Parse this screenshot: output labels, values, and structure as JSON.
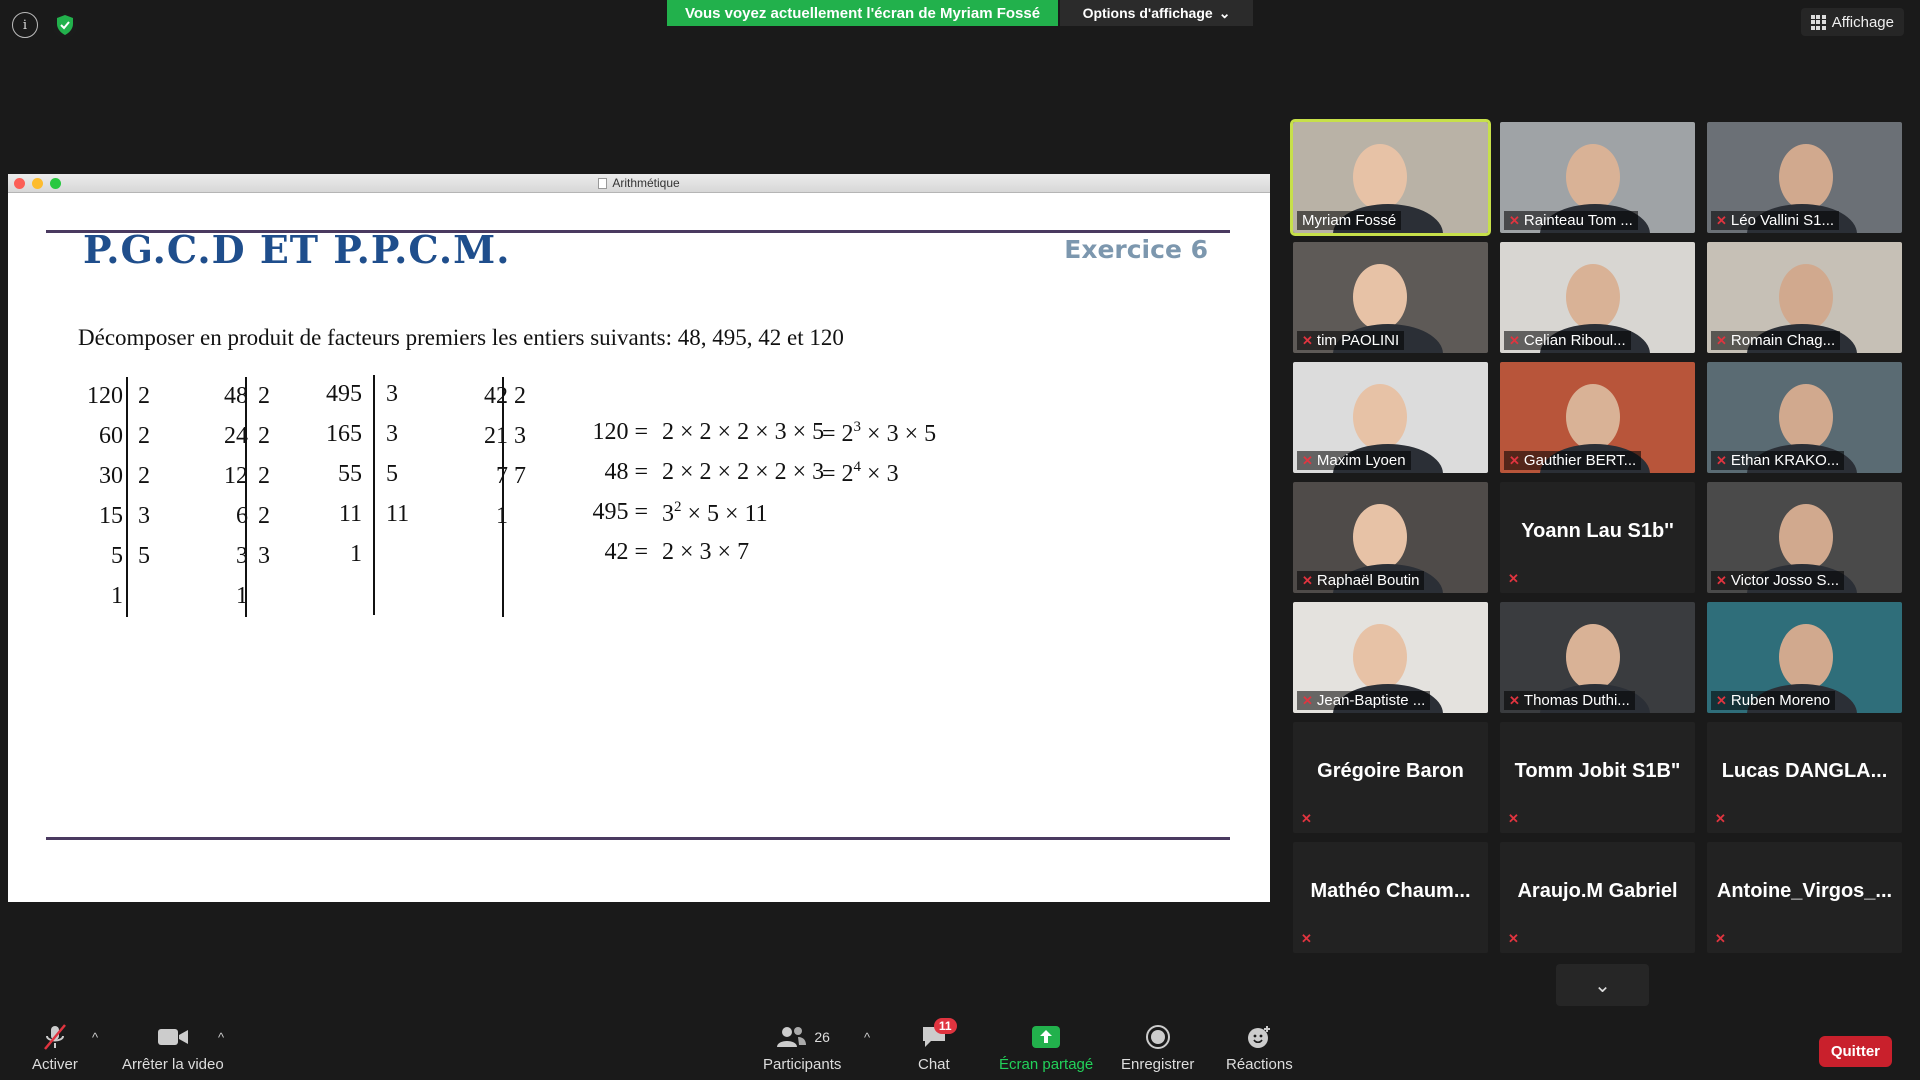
{
  "top": {
    "share_banner": "Vous voyez actuellement l'écran de Myriam Fossé",
    "view_options": "Options d'affichage",
    "view_button": "Affichage"
  },
  "window": {
    "title": "Arithmétique"
  },
  "slide": {
    "title": "P.G.C.D ET P.P.C.M.",
    "exercise": "Exercice 6",
    "instruction": "Décomposer en produit de facteurs premiers les entiers suivants: 48, 495, 42 et 120",
    "table120": {
      "left": [
        "120",
        "60",
        "30",
        "15",
        "5",
        "1"
      ],
      "right": [
        "2",
        "2",
        "2",
        "3",
        "5",
        ""
      ]
    },
    "table48": {
      "left": [
        "48",
        "24",
        "12",
        "6",
        "3",
        "1"
      ],
      "right": [
        "2",
        "2",
        "2",
        "2",
        "3",
        ""
      ]
    },
    "table495": {
      "left": [
        "495",
        "165",
        "55",
        "11",
        "1"
      ],
      "right": [
        "3",
        "3",
        "5",
        "11",
        ""
      ]
    },
    "table42": {
      "left": [
        "42",
        "21",
        "7",
        "1"
      ],
      "right": [
        "2",
        "3",
        "7",
        ""
      ]
    },
    "results": [
      {
        "lhs": "120 =",
        "rhs": "2 × 2 × 2 × 3 × 5",
        "pow": "= 2",
        "exp": "3",
        "rest": " × 3 × 5"
      },
      {
        "lhs": "48 =",
        "rhs": "2 × 2 × 2 × 2 × 3",
        "pow": "= 2",
        "exp": "4",
        "rest": " × 3"
      },
      {
        "lhs": "495 =",
        "rhs": "3",
        "exp": "2",
        "rest": " × 5 × 11"
      },
      {
        "lhs": "42 =",
        "rhs": "2 × 3 × 7"
      }
    ]
  },
  "participants": [
    {
      "name": "Myriam Fossé",
      "video": true,
      "active": true,
      "muted": false
    },
    {
      "name": "Rainteau Tom ...",
      "video": true,
      "muted": true
    },
    {
      "name": "Léo Vallini S1...",
      "video": true,
      "muted": true
    },
    {
      "name": "tim PAOLINI",
      "video": true,
      "muted": true
    },
    {
      "name": "Celian Riboul...",
      "video": true,
      "muted": true
    },
    {
      "name": "Romain Chag...",
      "video": true,
      "muted": true
    },
    {
      "name": "Maxim Lyoen",
      "video": true,
      "muted": true
    },
    {
      "name": "Gauthier BERT...",
      "video": true,
      "muted": true
    },
    {
      "name": "Ethan KRAKO...",
      "video": true,
      "muted": true
    },
    {
      "name": "Raphaël Boutin",
      "video": true,
      "muted": true
    },
    {
      "name": "Yoann Lau S1b''",
      "video": false,
      "muted": true
    },
    {
      "name": "Victor Josso S...",
      "video": true,
      "muted": true
    },
    {
      "name": "Jean-Baptiste ...",
      "video": true,
      "muted": true
    },
    {
      "name": "Thomas Duthi...",
      "video": true,
      "muted": true
    },
    {
      "name": "Ruben Moreno",
      "video": true,
      "muted": true
    },
    {
      "name": "Grégoire Baron",
      "video": false,
      "muted": true
    },
    {
      "name": "Tomm Jobit S1B\"",
      "video": false,
      "muted": true
    },
    {
      "name": "Lucas  DANGLA...",
      "video": false,
      "muted": true
    },
    {
      "name": "Mathéo  Chaum...",
      "video": false,
      "muted": true
    },
    {
      "name": "Araujo.M Gabriel",
      "video": false,
      "muted": true
    },
    {
      "name": "Antoine_Virgos_...",
      "video": false,
      "muted": true
    }
  ],
  "toolbar": {
    "mute": "Activer",
    "video": "Arrêter la video",
    "participants": "Participants",
    "participants_count": "26",
    "chat": "Chat",
    "chat_badge": "11",
    "share": "Écran partagé",
    "record": "Enregistrer",
    "reactions": "Réactions",
    "quit": "Quitter"
  },
  "colors": {
    "share_green": "#22b14c",
    "quit_red": "#c9202c",
    "slide_title_blue": "#1f4e8c",
    "active_speaker": "#c7e04a"
  }
}
